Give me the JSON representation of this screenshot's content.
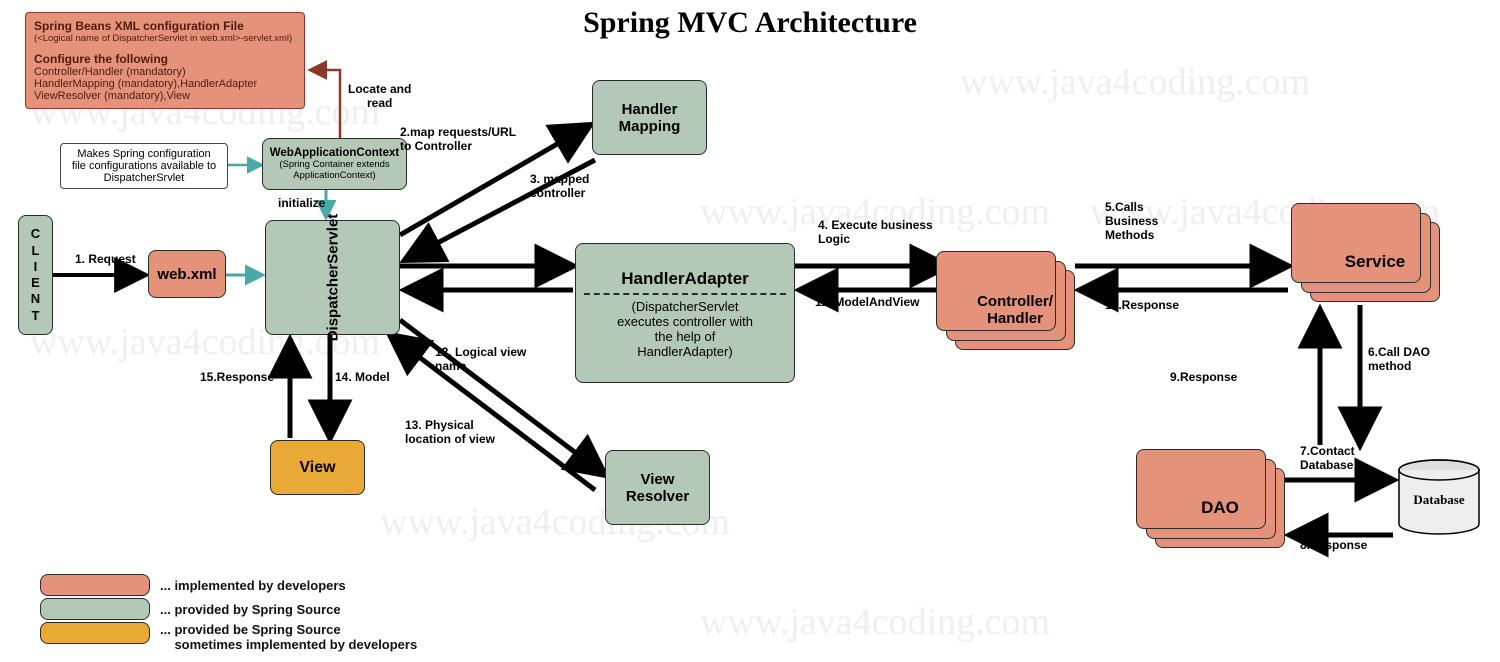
{
  "title": "Spring MVC Architecture",
  "boxes": {
    "client": "C\nL\nI\nE\nN\nT",
    "webxml": "web.xml",
    "dispatcher": "DispatcherServlet",
    "handler_mapping": "Handler\nMapping",
    "handler_adapter_title": "HandlerAdapter",
    "handler_adapter_sub": "(DispatcherServlet\nexecutes controller with\nthe help of\nHandlerAdapter)",
    "controller": "Controller/\nHandler",
    "service": "Service",
    "dao": "DAO",
    "database": "Database",
    "view_resolver": "View\nResolver",
    "view": "View",
    "wac": "WebApplicationContext",
    "wac_sub": "(Spring Container extends\nApplicationContext)",
    "wac_note": "Makes Spring configuration\nfile configurations available to\nDispatcherSrvlet"
  },
  "config_note": {
    "h1": "Spring Beans XML configuration File",
    "h1_sub": "(<Logical name of DispatcherServlet in web.xml>-servlet.xml)",
    "h2": "Configure the following",
    "lines": "Controller/Handler (mandatory)\nHandlerMapping (mandatory),HandlerAdapter\nViewResolver (mandatory),View"
  },
  "labels": {
    "l1": "1. Request",
    "l2": "2.map requests/URL\nto Controller",
    "l3": "3. mapped\ncontroller",
    "l4": "4. Execute business\nLogic",
    "l5": "5.Calls\nBusiness\nMethods",
    "l6": "6.Call DAO\nmethod",
    "l7": "7.Contact\nDatabase",
    "l8": "8.Response",
    "l9": "9.Response",
    "l10": "10.Response",
    "l11": "11. ModelAndView",
    "l12": "12. Logical view\nname",
    "l13": "13. Physical\nlocation of view",
    "l14": "14. Model",
    "l15": "15.Response",
    "initialize": "initialize",
    "locate_read": "Locate and\nread"
  },
  "legend": {
    "dev": "... implemented by developers",
    "spring": "... provided by Spring Source",
    "mixed": "... provided be Spring Source\n    sometimes implemented by developers"
  },
  "watermark": "www.java4coding.com"
}
